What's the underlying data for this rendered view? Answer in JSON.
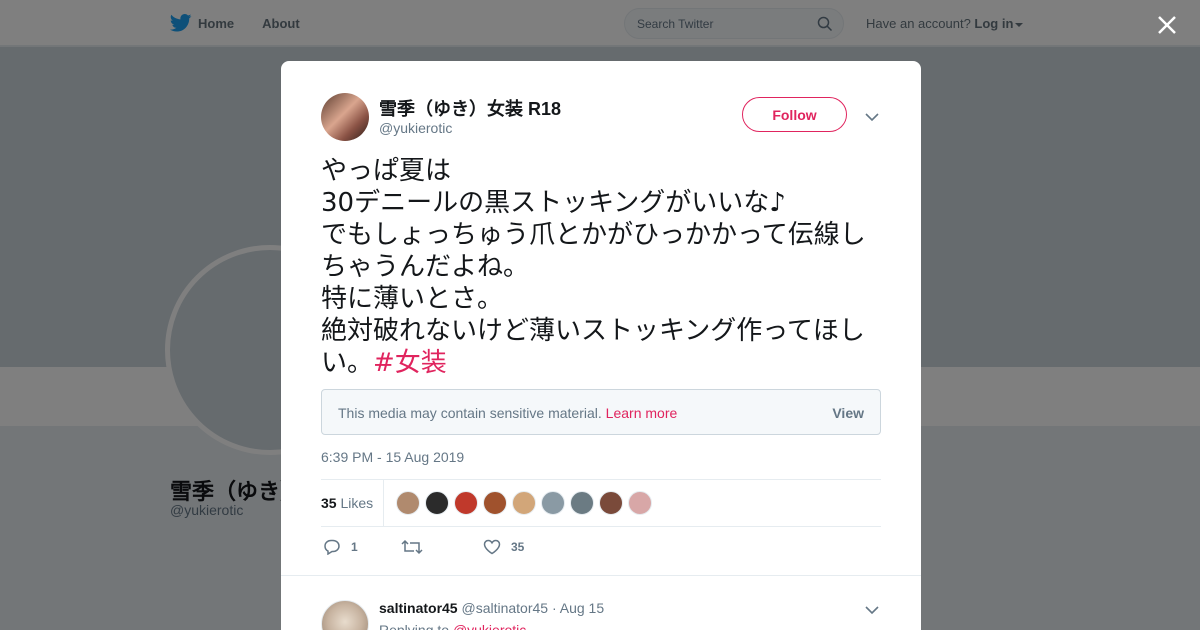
{
  "nav": {
    "home_label": "Home",
    "about_label": "About",
    "search_placeholder": "Search Twitter",
    "account_prompt": "Have an account?",
    "login_label": "Log in"
  },
  "profile": {
    "name": "雪季（ゆき）",
    "handle": "@yukierotic"
  },
  "tweet": {
    "author_name": "雪季（ゆき）女装 R18",
    "author_handle": "@yukierotic",
    "follow_label": "Follow",
    "lines": [
      "やっぱ夏は",
      "30デニールの黒ストッキングがいいな♪",
      "でもしょっちゅう爪とかがひっかかって伝線しちゃうんだよね。",
      "特に薄いとさ。",
      "絶対破れないけど薄いストッキング作ってほしい。"
    ],
    "hashtag": "#女装",
    "sensitive_message": "This media may contain sensitive material.",
    "learn_more": "Learn more",
    "view_label": "View",
    "timestamp": "6:39 PM - 15 Aug 2019",
    "likes_count": "35",
    "likes_label": "Likes",
    "liker_colors": [
      "#b08a6e",
      "#2b2b2b",
      "#c0392b",
      "#a0522d",
      "#d2a679",
      "#8a9aa4",
      "#6b7b83",
      "#7a4a3a",
      "#d8a7a7"
    ],
    "reply_count": "1",
    "retweet_count": "",
    "like_count": "35"
  },
  "reply": {
    "name": "saltinator45",
    "handle": "@saltinator45",
    "date": "· Aug 15",
    "replying_prefix": "Replying to",
    "replying_mention": "@yukierotic"
  },
  "colors": {
    "brand": "#1da1f2",
    "accent": "#e0245e",
    "muted": "#657786"
  }
}
